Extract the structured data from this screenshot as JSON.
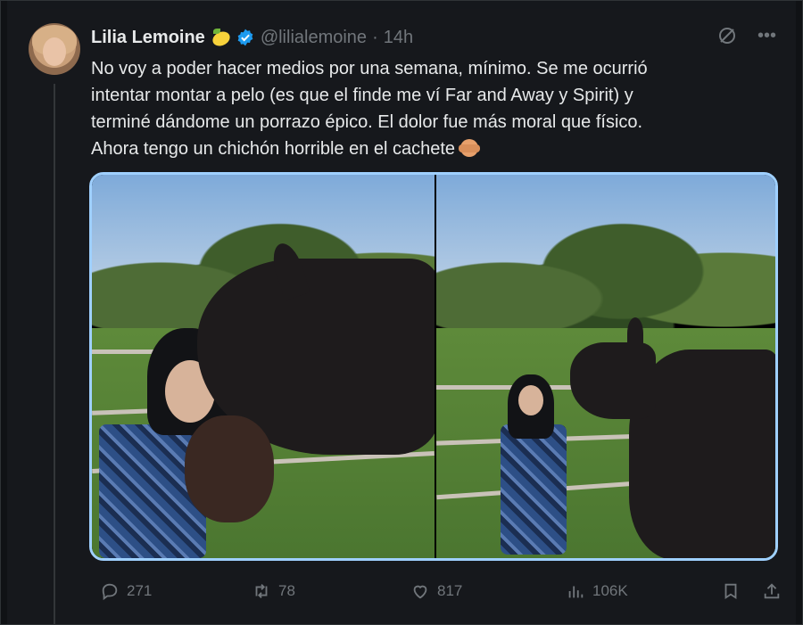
{
  "tweet": {
    "author_name": "Lilia Lemoine",
    "handle": "@lilialemoine",
    "separator": "·",
    "time": "14h",
    "text_lines": [
      "No voy a poder hacer medios por una semana, mínimo. Se me ocurrió",
      "intentar montar a pelo (es que el finde me ví Far and Away y Spirit) y",
      "terminé dándome un porrazo épico. El dolor fue más moral que físico.",
      "Ahora tengo un chichón horrible en el cachete"
    ],
    "icons": {
      "lemon": "lemon-emoji-icon",
      "verified": "verified-badge-icon",
      "grok": "grok-icon",
      "more": "more-options-icon",
      "face": "see-no-evil-emoji-icon"
    }
  },
  "actions": {
    "replies": "271",
    "retweets": "78",
    "likes": "817",
    "views": "106K"
  },
  "colors": {
    "background": "#16181c",
    "text": "#e7e9ea",
    "muted": "#71767b",
    "verified_blue": "#1d9bf0",
    "media_border": "#9fd0ff"
  }
}
